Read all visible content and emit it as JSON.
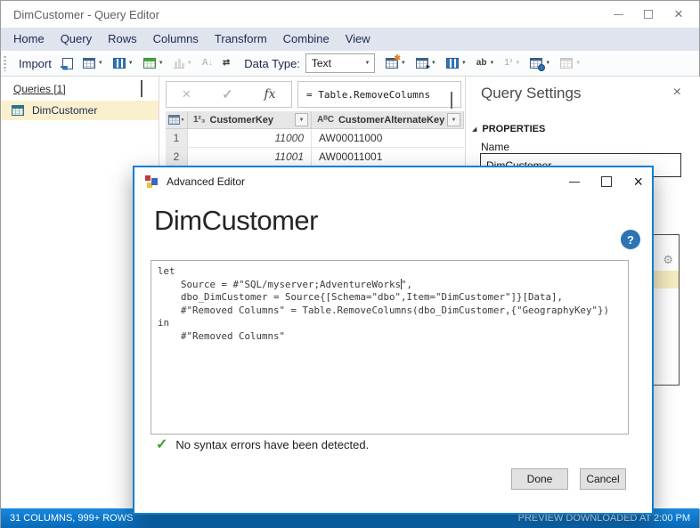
{
  "window": {
    "title": "DimCustomer - Query Editor"
  },
  "menu": {
    "items": [
      "Home",
      "Query",
      "Rows",
      "Columns",
      "Transform",
      "Combine",
      "View"
    ]
  },
  "toolbar": {
    "import_label": "Import",
    "data_type_label": "Data Type:",
    "data_type_value": "Text"
  },
  "queries_panel": {
    "header": "Queries [1]",
    "item_label": "DimCustomer"
  },
  "formula_bar": {
    "fx_label": "fx",
    "expression": "= Table.RemoveColumns"
  },
  "table": {
    "columns": [
      {
        "type": "1²₃",
        "label": "CustomerKey"
      },
      {
        "type": "AᴮC",
        "label": "CustomerAlternateKey"
      }
    ],
    "rows": [
      {
        "num": "1",
        "key": "11000",
        "alt": "AW00011000"
      },
      {
        "num": "2",
        "key": "11001",
        "alt": "AW00011001"
      }
    ]
  },
  "query_settings": {
    "title": "Query Settings",
    "properties_label": "PROPERTIES",
    "name_label": "Name",
    "name_value": "DimCustomer"
  },
  "dialog": {
    "title": "Advanced Editor",
    "heading": "DimCustomer",
    "help_glyph": "?",
    "code": [
      "let",
      "    Source = #\"SQL/myserver;AdventureWorks\",",
      "    dbo_DimCustomer = Source{[Schema=\"dbo\",Item=\"DimCustomer\"]}[Data],",
      "    #\"Removed Columns\" = Table.RemoveColumns(dbo_DimCustomer,{\"GeographyKey\"})",
      "in",
      "    #\"Removed Columns\""
    ],
    "status_message": "No syntax errors have been detected.",
    "done_label": "Done",
    "cancel_label": "Cancel"
  },
  "status_bar": {
    "left": "31 COLUMNS, 999+ ROWS",
    "right": "PREVIEW DOWNLOADED AT 2:00 PM"
  },
  "icons": {
    "close": "×",
    "check": "✓",
    "x_mark": "×",
    "caret_down": "▼",
    "gear": "⚙",
    "triangle": "◢",
    "sort": "A↓",
    "transpose": "⇄",
    "star": "✱",
    "arrow_right": "▸",
    "abc": "ab",
    "onetwothree": "1³"
  },
  "colors": {
    "accent": "#0078d7",
    "selection_yellow": "#fbf0ce",
    "success_green": "#3f9c35"
  }
}
